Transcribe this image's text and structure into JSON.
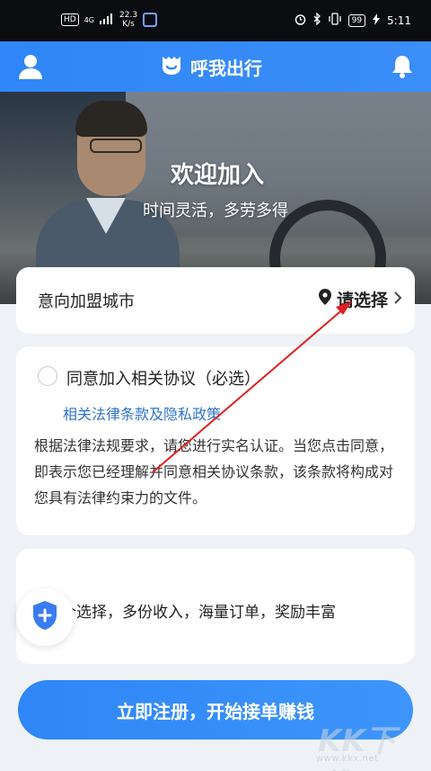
{
  "status_bar": {
    "hd_badge": "HD",
    "network": "4G",
    "speed_value": "22.3",
    "speed_unit": "K/s",
    "battery": "99",
    "time": "5:11"
  },
  "header": {
    "title": "呼我出行",
    "icons": [
      "user-icon",
      "bell-icon",
      "logo-icon"
    ]
  },
  "hero": {
    "title": "欢迎加入",
    "subtitle": "时间灵活，多劳多得"
  },
  "city": {
    "label": "意向加盟城市",
    "select_text": "请选择"
  },
  "agreement": {
    "title": "同意加入相关协议（必选）",
    "link_text": "相关法律条款及隐私政策",
    "description": "根据法律法规要求，请您进行实名认证。当您点击同意，即表示您已经理解并同意相关协议条款，该条款将构成对您具有法律约束力的文件。"
  },
  "features": {
    "text": "个选择，多份收入，海量订单，奖励丰富"
  },
  "cta": {
    "label": "立即注册，开始接单赚钱"
  },
  "watermark": {
    "logo_text": "KK下载",
    "url": "www.kkx.net"
  },
  "colors": {
    "brand_blue": "#2f86f6",
    "link_blue": "#2e74c9",
    "annotation_red": "#e02020"
  }
}
